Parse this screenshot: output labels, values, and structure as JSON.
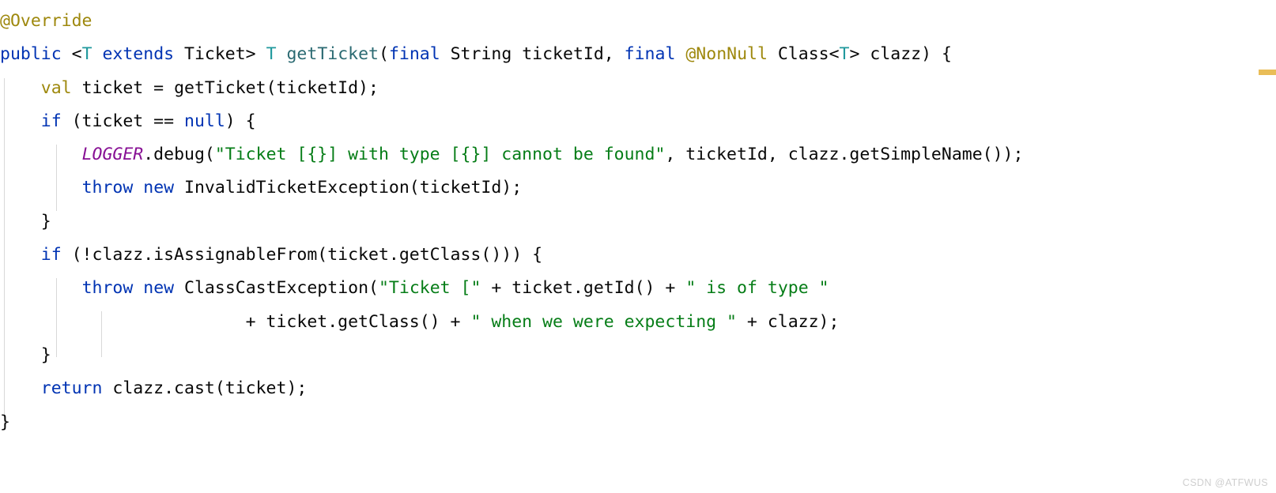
{
  "editor": {
    "language": "java",
    "background": "#ffffff",
    "font_size_px": 21.5,
    "line_height_px": 42.3,
    "indent_guide_color": "#d8d8d8"
  },
  "colors": {
    "keyword": "#0033b3",
    "annotation": "#9e880d",
    "generic_type": "#20999d",
    "method_name": "#2b6a72",
    "string": "#067d17",
    "static_field": "#871094",
    "default_text": "#080808",
    "inspection_marker": "#e9bd58",
    "watermark": "#cfcfcf"
  },
  "code": {
    "lines": [
      {
        "index": 1,
        "text": "@Override",
        "tokens": [
          {
            "t": "@Override",
            "c": "anno"
          }
        ]
      },
      {
        "index": 2,
        "text": "public <T extends Ticket> T getTicket(final String ticketId, final @NonNull Class<T> clazz) {",
        "tokens": [
          {
            "t": "public",
            "c": "kw"
          },
          {
            "t": " <",
            "c": "plain"
          },
          {
            "t": "T",
            "c": "gen"
          },
          {
            "t": " ",
            "c": "plain"
          },
          {
            "t": "extends",
            "c": "kw"
          },
          {
            "t": " Ticket> ",
            "c": "plain"
          },
          {
            "t": "T",
            "c": "gen"
          },
          {
            "t": " ",
            "c": "plain"
          },
          {
            "t": "getTicket",
            "c": "mth"
          },
          {
            "t": "(",
            "c": "plain"
          },
          {
            "t": "final",
            "c": "kw"
          },
          {
            "t": " String ticketId, ",
            "c": "plain"
          },
          {
            "t": "final",
            "c": "kw"
          },
          {
            "t": " ",
            "c": "plain"
          },
          {
            "t": "@NonNull",
            "c": "anno"
          },
          {
            "t": " Class<",
            "c": "plain"
          },
          {
            "t": "T",
            "c": "gen"
          },
          {
            "t": "> clazz) {",
            "c": "plain"
          }
        ]
      },
      {
        "index": 3,
        "text": "    val ticket = getTicket(ticketId);",
        "tokens": [
          {
            "t": "    ",
            "c": "plain"
          },
          {
            "t": "val",
            "c": "anno"
          },
          {
            "t": " ticket = getTicket(ticketId);",
            "c": "plain"
          }
        ]
      },
      {
        "index": 4,
        "text": "    if (ticket == null) {",
        "tokens": [
          {
            "t": "    ",
            "c": "plain"
          },
          {
            "t": "if",
            "c": "kw"
          },
          {
            "t": " (ticket == ",
            "c": "plain"
          },
          {
            "t": "null",
            "c": "kw"
          },
          {
            "t": ") {",
            "c": "plain"
          }
        ]
      },
      {
        "index": 5,
        "text": "        LOGGER.debug(\"Ticket [{}] with type [{}] cannot be found\", ticketId, clazz.getSimpleName());",
        "tokens": [
          {
            "t": "        ",
            "c": "plain"
          },
          {
            "t": "LOGGER",
            "c": "fld"
          },
          {
            "t": ".debug(",
            "c": "plain"
          },
          {
            "t": "\"Ticket [{}] with type [{}] cannot be found\"",
            "c": "str"
          },
          {
            "t": ", ticketId, clazz.getSimpleName());",
            "c": "plain"
          }
        ]
      },
      {
        "index": 6,
        "text": "        throw new InvalidTicketException(ticketId);",
        "tokens": [
          {
            "t": "        ",
            "c": "plain"
          },
          {
            "t": "throw",
            "c": "kw"
          },
          {
            "t": " ",
            "c": "plain"
          },
          {
            "t": "new",
            "c": "kw"
          },
          {
            "t": " InvalidTicketException(ticketId);",
            "c": "plain"
          }
        ]
      },
      {
        "index": 7,
        "text": "    }",
        "tokens": [
          {
            "t": "    }",
            "c": "plain"
          }
        ]
      },
      {
        "index": 8,
        "text": "    if (!clazz.isAssignableFrom(ticket.getClass())) {",
        "tokens": [
          {
            "t": "    ",
            "c": "plain"
          },
          {
            "t": "if",
            "c": "kw"
          },
          {
            "t": " (!clazz.isAssignableFrom(ticket.getClass())) {",
            "c": "plain"
          }
        ]
      },
      {
        "index": 9,
        "text": "        throw new ClassCastException(\"Ticket [\" + ticket.getId() + \" is of type \"",
        "tokens": [
          {
            "t": "        ",
            "c": "plain"
          },
          {
            "t": "throw",
            "c": "kw"
          },
          {
            "t": " ",
            "c": "plain"
          },
          {
            "t": "new",
            "c": "kw"
          },
          {
            "t": " ClassCastException(",
            "c": "plain"
          },
          {
            "t": "\"Ticket [\"",
            "c": "str"
          },
          {
            "t": " + ticket.getId() + ",
            "c": "plain"
          },
          {
            "t": "\" is of type \"",
            "c": "str"
          }
        ]
      },
      {
        "index": 10,
        "text": "                        + ticket.getClass() + \" when we were expecting \" + clazz);",
        "tokens": [
          {
            "t": "                        + ticket.getClass() + ",
            "c": "plain"
          },
          {
            "t": "\" when we were expecting \"",
            "c": "str"
          },
          {
            "t": " + clazz);",
            "c": "plain"
          }
        ]
      },
      {
        "index": 11,
        "text": "    }",
        "tokens": [
          {
            "t": "    }",
            "c": "plain"
          }
        ]
      },
      {
        "index": 12,
        "text": "    return clazz.cast(ticket);",
        "tokens": [
          {
            "t": "    ",
            "c": "plain"
          },
          {
            "t": "return",
            "c": "kw"
          },
          {
            "t": " clazz.cast(ticket);",
            "c": "plain"
          }
        ]
      },
      {
        "index": 13,
        "text": "}",
        "tokens": [
          {
            "t": "}",
            "c": "plain"
          }
        ]
      }
    ]
  },
  "inspection_marker": {
    "label": "warning-stripe",
    "color": "#e9bd58"
  },
  "watermark": {
    "text": "CSDN @ATFWUS"
  }
}
